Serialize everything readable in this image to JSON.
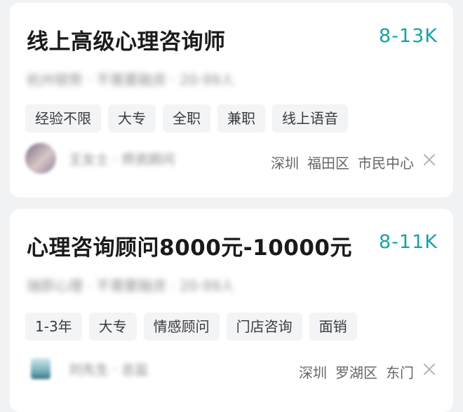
{
  "jobs": [
    {
      "title": "线上高级心理咨询师",
      "salary": "8-13K",
      "company_info": "杭州顿势 · 不需要融资 · 20-99人",
      "tags": [
        "经验不限",
        "大专",
        "全职",
        "兼职",
        "线上语音"
      ],
      "recruiter": "王女士 · 师资顾问",
      "location": [
        "深圳",
        "福田区",
        "市民中心"
      ],
      "close_icon": "close-icon"
    },
    {
      "title": "心理咨询顾问8000元-10000元",
      "salary": "8-11K",
      "company_info": "瑞即心理 · 不需要融资 · 20-99人",
      "tags": [
        "1-3年",
        "大专",
        "情感顾问",
        "门店咨询",
        "面销"
      ],
      "recruiter": "刘先生 · 总监",
      "location": [
        "深圳",
        "罗湖区",
        "东门"
      ],
      "close_icon": "close-icon"
    }
  ],
  "colors": {
    "salary": "#16a3a6",
    "background": "#f1f2f4",
    "tag_background": "#f3f4f6"
  }
}
